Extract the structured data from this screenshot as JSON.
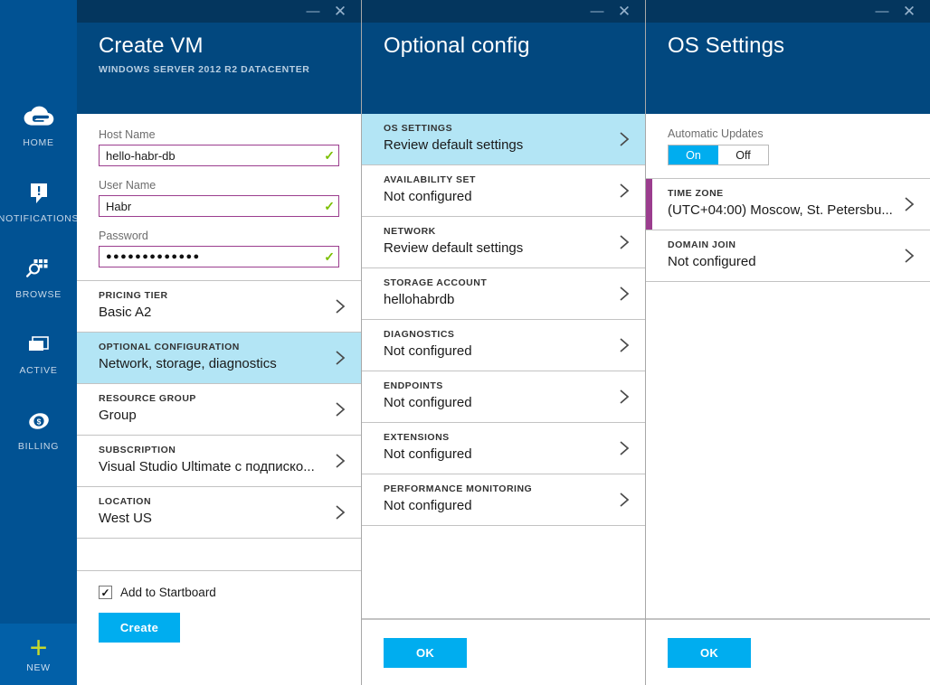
{
  "sidebar": {
    "items": [
      {
        "label": "HOME",
        "icon": "cloud-icon"
      },
      {
        "label": "NOTIFICATIONS",
        "icon": "alert-icon"
      },
      {
        "label": "BROWSE",
        "icon": "browse-search-icon"
      },
      {
        "label": "ACTIVE",
        "icon": "active-window-icon"
      },
      {
        "label": "BILLING",
        "icon": "billing-coin-icon"
      }
    ],
    "new_button": {
      "label": "NEW",
      "icon": "plus-icon"
    }
  },
  "blade1": {
    "title": "Create VM",
    "subtitle": "WINDOWS SERVER 2012 R2 DATACENTER",
    "minimize_icon": "minimize-icon",
    "close_icon": "close-icon",
    "fields": [
      {
        "label": "Host Name",
        "value": "hello-habr-db",
        "placeholder": "Host Name",
        "valid": "✓"
      },
      {
        "label": "User Name",
        "value": "Habr",
        "placeholder": "User Name",
        "valid": "✓"
      },
      {
        "label": "Password",
        "value": "●●●●●●●●●●●●●",
        "placeholder": "Password",
        "valid": "✓"
      }
    ],
    "rows": [
      {
        "kicker": "PRICING TIER",
        "value": "Basic A2",
        "selected": false
      },
      {
        "kicker": "OPTIONAL CONFIGURATION",
        "value": "Network, storage, diagnostics",
        "selected": true
      },
      {
        "kicker": "RESOURCE GROUP",
        "value": "Group",
        "selected": false
      },
      {
        "kicker": "SUBSCRIPTION",
        "value": "Visual Studio Ultimate с подписко...",
        "selected": false
      },
      {
        "kicker": "LOCATION",
        "value": "West US",
        "selected": false
      }
    ],
    "startboard": {
      "label": "Add to Startboard",
      "checked": true,
      "mark": "✓"
    },
    "create_button": "Create"
  },
  "blade2": {
    "title": "Optional config",
    "minimize_icon": "minimize-icon",
    "close_icon": "close-icon",
    "rows": [
      {
        "kicker": "OS SETTINGS",
        "value": "Review default settings",
        "selected": true
      },
      {
        "kicker": "AVAILABILITY SET",
        "value": "Not configured",
        "selected": false
      },
      {
        "kicker": "NETWORK",
        "value": "Review default settings",
        "selected": false
      },
      {
        "kicker": "STORAGE ACCOUNT",
        "value": "hellohabrdb",
        "selected": false
      },
      {
        "kicker": "DIAGNOSTICS",
        "value": "Not configured",
        "selected": false
      },
      {
        "kicker": "ENDPOINTS",
        "value": "Not configured",
        "selected": false
      },
      {
        "kicker": "EXTENSIONS",
        "value": "Not configured",
        "selected": false
      },
      {
        "kicker": "PERFORMANCE MONITORING",
        "value": "Not configured",
        "selected": false
      }
    ],
    "ok_button": "OK"
  },
  "blade3": {
    "title": "OS Settings",
    "minimize_icon": "minimize-icon",
    "close_icon": "close-icon",
    "auto_updates": {
      "label": "Automatic Updates",
      "on_label": "On",
      "off_label": "Off",
      "selected": "On"
    },
    "rows": [
      {
        "kicker": "TIME ZONE",
        "value": "(UTC+04:00) Moscow, St. Petersbu...",
        "accent": true
      },
      {
        "kicker": "DOMAIN JOIN",
        "value": "Not configured",
        "accent": false
      }
    ],
    "ok_button": "OK"
  },
  "colors": {
    "sidebar_bg": "#015293",
    "blade_header_bg": "#02487f",
    "titlebar_bg": "#04365e",
    "accent_cyan": "#00adef",
    "selected_row": "#b3e5f5",
    "accent_purple": "#9b3d8e",
    "valid_green": "#7bbf00",
    "new_green": "#c6d92c"
  }
}
